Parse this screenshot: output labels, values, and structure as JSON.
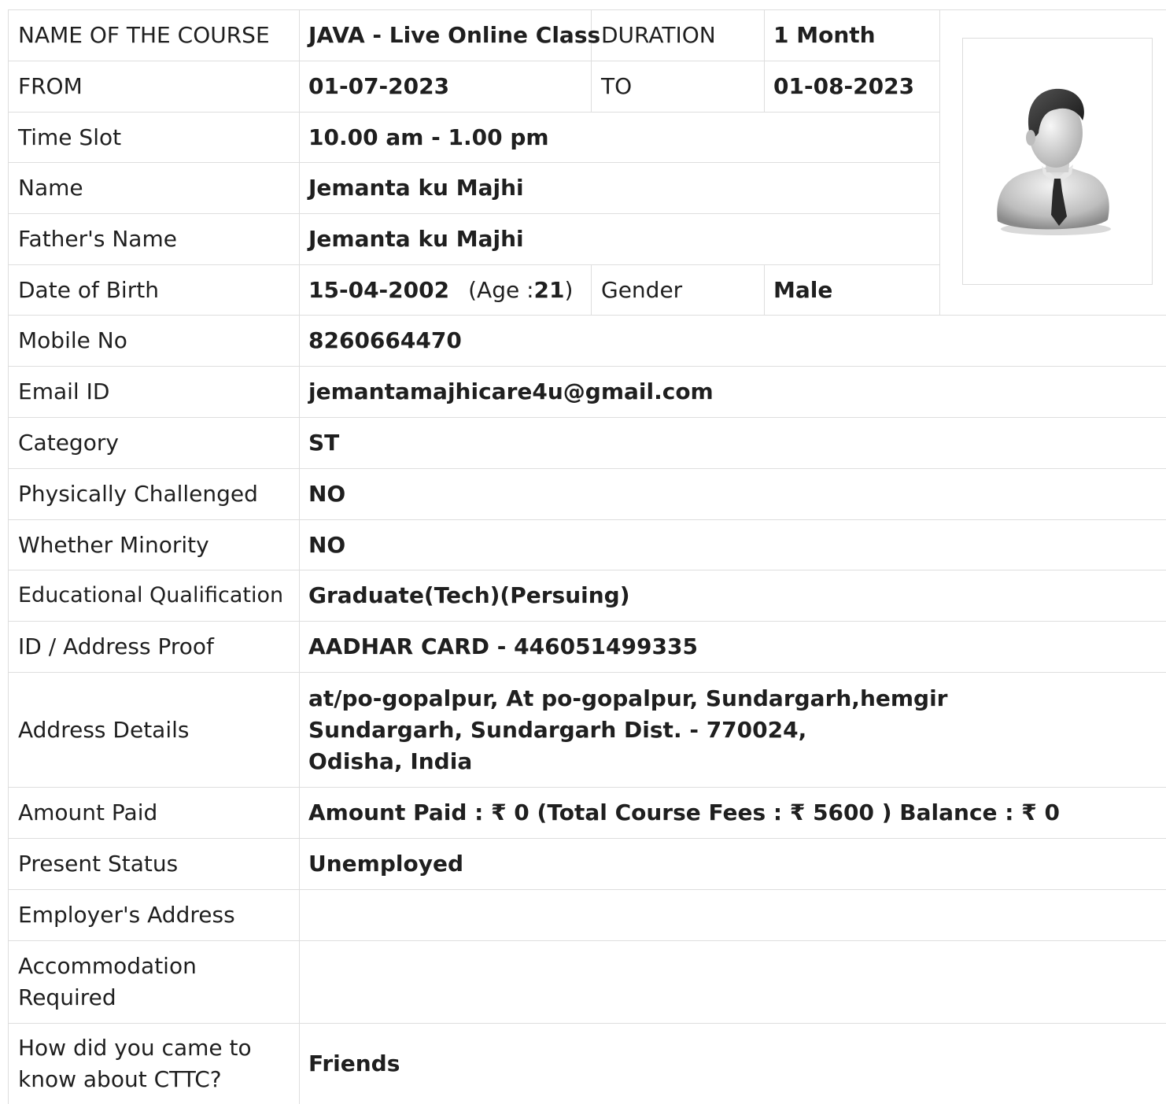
{
  "course": {
    "name_label": "NAME OF THE COURSE",
    "name_value": "JAVA - Live Online Class",
    "duration_label": "DURATION",
    "duration_value": "1 Month",
    "from_label": "FROM",
    "from_value": "01-07-2023",
    "to_label": "TO",
    "to_value": "01-08-2023",
    "time_slot_label": "Time Slot",
    "time_slot_value": "10.00 am - 1.00 pm"
  },
  "photo": {
    "icon": "user-avatar-icon"
  },
  "student": {
    "name_label": "Name",
    "name_value": "Jemanta ku Majhi",
    "father_label": "Father's Name",
    "father_value": "Jemanta ku Majhi",
    "dob_label": "Date of Birth",
    "dob_value": "15-04-2002",
    "age_prefix": "(Age : ",
    "age_value": "21",
    "age_suffix": ")",
    "gender_label": "Gender",
    "gender_value": "Male",
    "mobile_label": "Mobile No",
    "mobile_value": "8260664470",
    "email_label": "Email ID",
    "email_value": "jemantamajhicare4u@gmail.com",
    "category_label": "Category",
    "category_value": "ST",
    "pc_label": "Physically Challenged",
    "pc_value": "NO",
    "minority_label": "Whether Minority",
    "minority_value": "NO",
    "edu_label": "Educational Qualification",
    "edu_value": "Graduate(Tech)(Persuing)",
    "idproof_label": "ID / Address Proof",
    "idproof_value": "AADHAR CARD - 446051499335",
    "address_label": "Address Details",
    "address_line1": "at/po-gopalpur, At po-gopalpur, Sundargarh,hemgir",
    "address_line2": "Sundargarh, Sundargarh Dist. - 770024,",
    "address_line3": "Odisha, India",
    "amount_label": "Amount Paid",
    "amount_value": "Amount Paid : ₹ 0 (Total Course Fees : ₹ 5600 ) Balance : ₹ 0",
    "status_label": "Present Status",
    "status_value": "Unemployed",
    "employer_label": "Employer's Address",
    "employer_value": "",
    "accommodation_label": "Accommodation Required",
    "accommodation_value": "",
    "source_label": "How did you came to know about CTTC?",
    "source_value": "Friends"
  }
}
